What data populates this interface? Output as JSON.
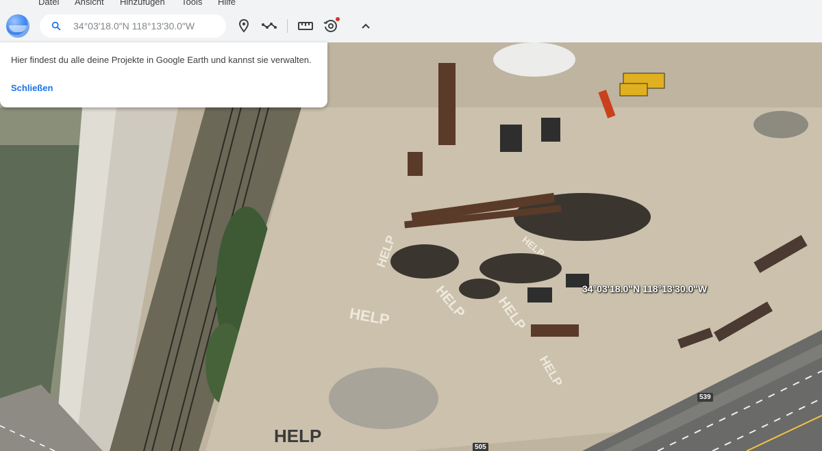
{
  "menu": [
    "Datei",
    "Ansicht",
    "Hinzufügen",
    "Tools",
    "Hilfe"
  ],
  "search": {
    "placeholder": "34°03′18.0″N 118°13′30.0″W"
  },
  "toolbar": {
    "icons": [
      "search-icon",
      "map-pin-icon",
      "path-icon",
      "ruler-icon",
      "history-icon",
      "chevron-up-icon"
    ]
  },
  "popup": {
    "message": "Hier findest du alle deine Projekte in Google Earth und kannst sie verwalten.",
    "close_label": "Schließen"
  },
  "map": {
    "placemark_label": "34°03'18.0\"N 118°13'30.0\"W",
    "ground_text": [
      "HELP",
      "HELP",
      "HELP",
      "HELP",
      "HELP",
      "HELP",
      "HELP"
    ],
    "road_shields": [
      "539",
      "505"
    ]
  },
  "colors": {
    "accent": "#1a73e8",
    "pin": "#d93025",
    "chrome": "#f1f3f4"
  }
}
